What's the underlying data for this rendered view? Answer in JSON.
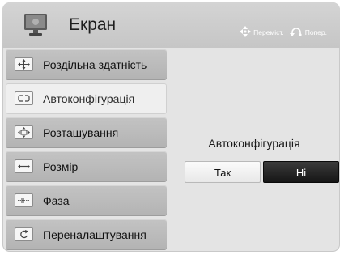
{
  "header": {
    "title": "Екран",
    "hint_move": "Переміст.",
    "hint_back": "Попер."
  },
  "menu": {
    "items": [
      {
        "label": "Роздільна здатність",
        "icon": "resolution-icon",
        "active": false
      },
      {
        "label": "Автоконфігурація",
        "icon": "auto-config-icon",
        "active": true
      },
      {
        "label": "Розташування",
        "icon": "position-icon",
        "active": false
      },
      {
        "label": "Розмір",
        "icon": "size-icon",
        "active": false
      },
      {
        "label": "Фаза",
        "icon": "phase-icon",
        "active": false
      },
      {
        "label": "Переналаштування",
        "icon": "reset-icon",
        "active": false
      }
    ]
  },
  "content": {
    "title": "Автоконфігурація",
    "yes_label": "Так",
    "no_label": "Ні",
    "selected": "no"
  },
  "colors": {
    "background": "#e4e4e4",
    "header": "#cccccc",
    "selected_button": "#1f1f1f"
  }
}
